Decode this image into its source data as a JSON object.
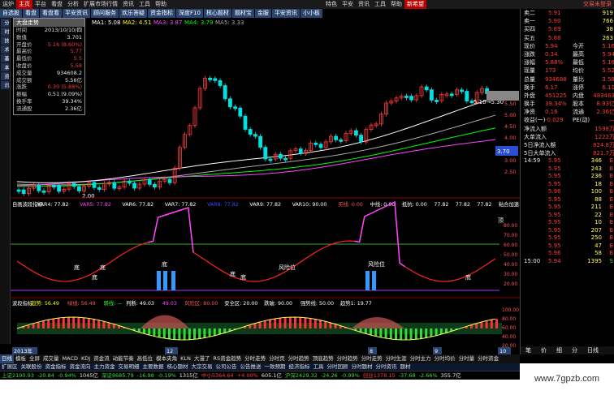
{
  "menubar": {
    "items": [
      "运炉",
      "主页",
      "平台",
      "看盘",
      "分析",
      "扩展市场行情",
      "资讯",
      "工具",
      "帮助"
    ],
    "center_items": [
      "特色",
      "平安",
      "资讯",
      "工具",
      "帮助"
    ],
    "stock_name": "新希望",
    "tag": "交易未登录"
  },
  "tabs2": [
    "自选股",
    "看盘",
    "看盘看",
    "平安资讯",
    "顾问服务",
    "欢乐答疑",
    "资金指标",
    "深度F10",
    "核心题材",
    "题材宝",
    "金服",
    "平安资讯",
    "小小板"
  ],
  "info": {
    "title": "大盘走势",
    "rows": [
      {
        "k": "时间",
        "v": "2013/10/10/四"
      },
      {
        "k": "数值",
        "v": "3.701"
      },
      {
        "k": "开盘价",
        "v": "5.16 (8.60%)"
      },
      {
        "k": "最高价",
        "v": "5.77"
      },
      {
        "k": "最低价",
        "v": "5.5"
      },
      {
        "k": "收盘价",
        "v": "5.58"
      },
      {
        "k": "成交量",
        "v": "934608.2"
      },
      {
        "k": "成交额",
        "v": "5.56亿"
      },
      {
        "k": "涨跌",
        "v": "0.30 (5.88%)"
      },
      {
        "k": "振幅",
        "v": "0.51 (9.09%)"
      },
      {
        "k": "换手率",
        "v": "39.34%"
      },
      {
        "k": "流通股",
        "v": "2.36亿"
      }
    ]
  },
  "main_chart": {
    "ma_legend": [
      "MA1: 5.08",
      "MA2: 4.51",
      "MA3: 3.87",
      "MA4: 3.79",
      "MA5: 3.33"
    ],
    "price_axis": [
      "5.50",
      "5.00",
      "4.50",
      "4.00",
      "3.50",
      "3.00",
      "2.50"
    ],
    "marker_high": "5.10→5.30",
    "marker_low": "2.00",
    "right_box": "3.70"
  },
  "sub1": {
    "legend": [
      "自画波段指标",
      "VAR4: 77.82",
      "VAR5: 77.82",
      "VAR6: 77.82",
      "VAR7: 77.82",
      "VAR8: 77.82",
      "VAR9: 77.82",
      "VAR10: 90.00",
      "买线: 0.00",
      "中线: 0.00",
      "抵抗: 0.00",
      "77.82",
      "77.82",
      "77.82",
      "粘合加速: 2",
      "00.00",
      "加速: 0.00"
    ],
    "labels": [
      "底",
      "底",
      "底",
      "风险位",
      "底",
      "底",
      "风险位",
      "底",
      "底"
    ],
    "axis": [
      "80.00",
      "70.00",
      "60.00",
      "50.00",
      "40.00",
      "30.00",
      "20.00"
    ],
    "top_tag": "顶"
  },
  "sub2": {
    "legend": [
      "波段指标",
      "趋势: 56.49",
      "绿线: 56.49",
      "转线: —",
      "判断: 49.03",
      "49.03",
      "风险区: 80.00",
      "安全区: 20.00",
      "跌破: 90.00",
      "强势线: 50.00",
      "趋势1: 19.77"
    ],
    "axis": [
      "100.00",
      "80.00",
      "60.00",
      "40.00",
      "20.00"
    ],
    "xaxis": [
      "2013年",
      "12",
      "8",
      "9",
      "10"
    ]
  },
  "right_panel": {
    "asks": [
      {
        "label": "卖二",
        "price": "5.91",
        "vol": "919"
      },
      {
        "label": "卖一",
        "price": "5.90",
        "vol": "766"
      },
      {
        "label": "买四",
        "price": "5.89",
        "vol": "38"
      },
      {
        "label": "买五",
        "price": "5.88",
        "vol": "263"
      }
    ],
    "quote": [
      {
        "k": "现价",
        "v": "5.94",
        "k2": "今开",
        "v2": "5.16"
      },
      {
        "k": "涨跌",
        "v": "0.34",
        "k2": "最高",
        "v2": "5.94"
      },
      {
        "k": "涨幅",
        "v": "5.88%",
        "k2": "最低",
        "v2": "5.16"
      },
      {
        "k": "现量",
        "v": "173",
        "k2": "均价",
        "v2": "5.52"
      },
      {
        "k": "总量",
        "v": "934688",
        "k2": "量比",
        "v2": "3.58"
      },
      {
        "k": "换手",
        "v": "6.17",
        "k2": "涨停",
        "v2": "6.11"
      },
      {
        "k": "外盘",
        "v": "451225",
        "k2": "内盘",
        "v2": "483463"
      },
      {
        "k": "换手",
        "v": "39.34%",
        "k2": "股本",
        "v2": "8.93亿"
      },
      {
        "k": "净资",
        "v": "0.16",
        "k2": "流通",
        "v2": "2.36亿"
      },
      {
        "k": "收益(一)",
        "v": "-0.029",
        "k2": "PE(动)",
        "v2": "—"
      }
    ],
    "flows": [
      {
        "k": "净流入额",
        "v": "1598万"
      },
      {
        "k": "大单流入",
        "v": "1222万"
      },
      {
        "k": "5日净流入额",
        "v": "824.8万"
      },
      {
        "k": "5日大单流入",
        "v": "821.7万"
      }
    ],
    "ticks": [
      {
        "t": "14:59",
        "p": "5.95",
        "v": "346",
        "d": "B"
      },
      {
        "t": "",
        "p": "5.95",
        "v": "243",
        "d": "B"
      },
      {
        "t": "",
        "p": "5.95",
        "v": "236",
        "d": "B"
      },
      {
        "t": "",
        "p": "5.95",
        "v": "18",
        "d": "B"
      },
      {
        "t": "",
        "p": "5.96",
        "v": "100",
        "d": "B"
      },
      {
        "t": "",
        "p": "5.95",
        "v": "88",
        "d": "B"
      },
      {
        "t": "",
        "p": "5.95",
        "v": "211",
        "d": "B"
      },
      {
        "t": "",
        "p": "5.95",
        "v": "22",
        "d": "B"
      },
      {
        "t": "",
        "p": "5.95",
        "v": "10",
        "d": "B"
      },
      {
        "t": "",
        "p": "5.95",
        "v": "207",
        "d": "B"
      },
      {
        "t": "",
        "p": "5.95",
        "v": "250",
        "d": "B"
      },
      {
        "t": "",
        "p": "5.95",
        "v": "47",
        "d": "B"
      },
      {
        "t": "",
        "p": "5.96",
        "v": "58",
        "d": "B"
      },
      {
        "t": "15:00",
        "p": "5.94",
        "v": "1395",
        "d": "S"
      }
    ],
    "tabs": [
      "笔",
      "价",
      "细",
      "分"
    ],
    "bottom_tab": "日线"
  },
  "bottomtabs": [
    "日线",
    "模板",
    "全屏",
    "成交量",
    "MACD",
    "KDJ",
    "资金流",
    "动能节奏",
    "高低位",
    "模本夹角",
    "KLN",
    "大漫了",
    "RS资金趋势",
    "分时走势",
    "分时页",
    "分时趋势",
    "顶底趋势",
    "分时趋势",
    "分时走势",
    "分时生涯",
    "分时主力",
    "分时均价",
    "分时量",
    "分时资金"
  ],
  "toolrow": [
    "扩展区",
    "关联股份",
    "资金指标",
    "资金流向",
    "主力资金",
    "交易明细",
    "主要数据",
    "核心题材",
    "大宗交易",
    "公司公告",
    "公告推送",
    "一致预期",
    "经济指标",
    "工具",
    "分时回顾",
    "分时题材",
    "分时资讯",
    "题材"
  ],
  "status": [
    {
      "t": "上证2190.93",
      "c": "grn"
    },
    {
      "t": "-20.84",
      "c": "grn"
    },
    {
      "t": "-0.94%",
      "c": "grn"
    },
    {
      "t": "1045亿",
      "c": "wht"
    },
    {
      "t": "深证8685.79",
      "c": "grn"
    },
    {
      "t": "-16.98",
      "c": "grn"
    },
    {
      "t": "-0.19%",
      "c": "grn"
    },
    {
      "t": "1315亿",
      "c": "wht"
    },
    {
      "t": "中小5364.64",
      "c": "red"
    },
    {
      "t": "+4.00%",
      "c": "red"
    },
    {
      "t": "605.1亿",
      "c": "wht"
    },
    {
      "t": "沪深2429.32",
      "c": "grn"
    },
    {
      "t": "-24.26",
      "c": "grn"
    },
    {
      "t": "-0.99%",
      "c": "grn"
    },
    {
      "t": "创业1378.15",
      "c": "red"
    },
    {
      "t": "-37.68",
      "c": "grn"
    },
    {
      "t": "-2.66%",
      "c": "grn"
    },
    {
      "t": "355.7亿",
      "c": "wht"
    }
  ],
  "watermark": "www.7gpzb.com",
  "colors": {
    "up": "#ff3b3b",
    "down": "#00e0e0",
    "ma1": "#ffffff",
    "ma2": "#ffff00",
    "ma3": "#ff44ff",
    "ma4": "#00ff00",
    "ma5": "#aaaaaa"
  }
}
